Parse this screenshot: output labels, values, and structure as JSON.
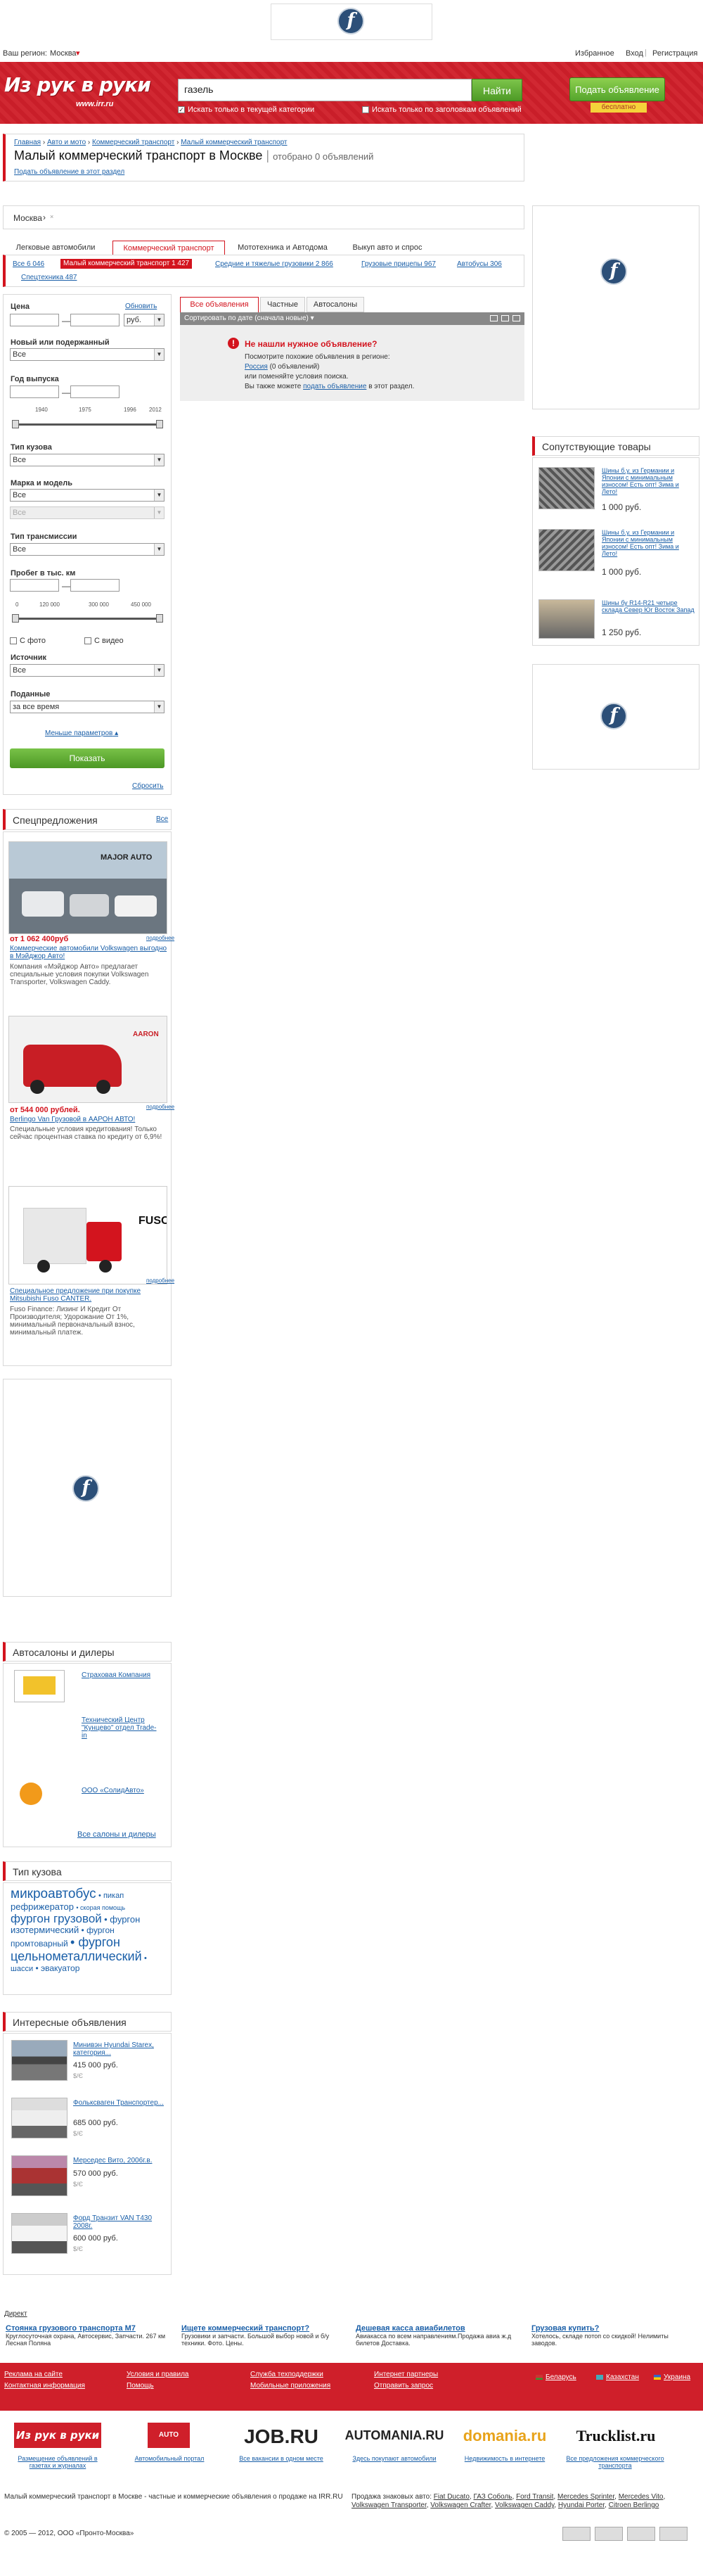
{
  "top": {
    "region_label": "Ваш регион:",
    "region_value": "Москва",
    "favorites": "Избранное",
    "login": "Вход",
    "register": "Регистрация"
  },
  "header": {
    "logo": "Из рук в руки",
    "logo_domain": "www.irr.ru",
    "search_value": "газель",
    "search_button": "Найти",
    "chk_category": "Искать только в текущей категории",
    "chk_titles": "Искать только по заголовкам объявлений",
    "post_ad": "Подать объявление",
    "free": "бесплатно"
  },
  "breadcrumb": [
    "Главная",
    "Авто и мото",
    "Коммерческий транспорт",
    "Малый коммерческий транспорт"
  ],
  "page": {
    "title": "Малый коммерческий транспорт в Москве",
    "found": "отобрано 0 объявлений",
    "post_link": "Подать объявление в этот раздел"
  },
  "location": {
    "city": "Москва",
    "arrow": "›"
  },
  "cat_tabs": [
    "Легковые автомобили",
    "Коммерческий транспорт",
    "Мототехника и Автодома",
    "Выкуп авто и спрос"
  ],
  "subcats": [
    "Все 6 046",
    "Малый коммерческий транспорт 1 427",
    "Средние и тяжелые грузовики 2 866",
    "Грузовые прицепы 967",
    "Автобусы 306",
    "Спецтехника 487"
  ],
  "filters": {
    "price_label": "Цена",
    "price_reset": "Обновить",
    "currency": "руб.",
    "new_label": "Новый или подержанный",
    "new_value": "Все",
    "year_label": "Год выпуска",
    "year_ticks": [
      "1940",
      "1975",
      "1996",
      "2012"
    ],
    "body_label": "Тип кузова",
    "body_value": "Все",
    "make_label": "Марка и модель",
    "make_value": "Все",
    "model_value": "Все",
    "trans_label": "Тип трансмиссии",
    "trans_value": "Все",
    "mileage_label": "Пробег в тыс. км",
    "mileage_ticks": [
      "0",
      "120 000",
      "300 000",
      "450 000"
    ],
    "photo": "С фото",
    "video": "С видео",
    "source_label": "Источник",
    "source_value": "Все",
    "posted_label": "Поданные",
    "posted_value": "за все время",
    "less_params": "Меньше параметров",
    "show": "Показать",
    "reset": "Сбросить"
  },
  "result_tabs": [
    "Все объявления",
    "Частные",
    "Автосалоны"
  ],
  "sort_label": "Сортировать по дате (сначала новые)",
  "notfound": {
    "title": "Не нашли нужное объявление?",
    "l1": "Посмотрите похожие объявления в регионе:",
    "region": "Россия",
    "region_count": "(0 объявлений)",
    "l2": "или поменяйте условия поиска.",
    "l3": "Вы также можете",
    "l3_link": "подать объявление",
    "l3_end": "в этот раздел."
  },
  "related": {
    "title": "Сопутствующие товары",
    "items": [
      {
        "text": "Шины б.у. из Германии и Японии с минимальным износом! Есть опт! Зима и Лето!",
        "price": "1 000 руб."
      },
      {
        "text": "Шины б.у. из Германии и Японии с минимальным износом! Есть опт! Зима и Лето!",
        "price": "1 000 руб."
      },
      {
        "text": "Шины бу R14-R21 четыре склада Север Юг Восток Запад",
        "price": "1 250 руб."
      }
    ]
  },
  "special": {
    "title": "Спецпредложения",
    "all": "Все",
    "promo": "подробнее",
    "items": [
      {
        "price": "от 1 062 400руб",
        "link": "Коммерческие автомобили Volkswagen выгодно в Мэйджор Авто!",
        "text": "Компания «Мэйджор Авто» предлагает специальные условия покупки Volkswagen Transporter, Volkswagen Caddy."
      },
      {
        "price": "от 544 000 рублей.",
        "link": "Berlingo Van Грузовой в ААРОН АВТО!",
        "text": "Специальные условия кредитования! Только сейчас процентная ставка по кредиту от 6,9%!"
      },
      {
        "price": "",
        "link": "Специальное предложение при покупке Mitsubishi Fuso CANTER.",
        "text": "Fuso Finance: Лизинг И Кредит От Производителя; Удорожание От 1%, минимальный первоначальный взнос, минимальный платеж."
      }
    ]
  },
  "dealers": {
    "title": "Автосалоны и дилеры",
    "items": [
      "Страховая Компания",
      "Технический Центр \"Кунцево\" отдел Trade-in",
      "ООО «СолидАвто»"
    ],
    "all": "Все салоны и дилеры"
  },
  "body_types": {
    "title": "Тип кузова",
    "tags": [
      "микроавтобус",
      "пикап",
      "рефрижератор",
      "скорая помощь",
      "фургон грузовой",
      "фургон изотермический",
      "фургон",
      "промтоварный",
      "фургон",
      "цельнометаллический",
      "шасси",
      "эвакуатор"
    ]
  },
  "interesting": {
    "title": "Интересные объявления",
    "items": [
      {
        "title": "Минивэн Hyundai Starex, категория...",
        "price": "415 000 руб.",
        "cur": "$/Є"
      },
      {
        "title": "Фольксваген Транспортер...",
        "price": "685 000 руб.",
        "cur": "$/Є"
      },
      {
        "title": "Мерседес Вито, 2006г.в.",
        "price": "570 000 руб.",
        "cur": "$/Є"
      },
      {
        "title": "Форд Транзит VAN T430 2008г.",
        "price": "600 000 руб.",
        "cur": "$/Є"
      }
    ]
  },
  "direct": {
    "label": "Директ",
    "ads": [
      {
        "title": "Стоянка грузового транспорта М7",
        "text": "Круглосуточная охрана, Автосервис, Запчасти. 267 км Лесная Поляна"
      },
      {
        "title": "Ищете коммерческий транспорт?",
        "text": "Грузовики и запчасти. Большой выбор новой и б/у техники. Фото. Цены."
      },
      {
        "title": "Дешевая касса авиабилетов",
        "text": "Авиакасса по всем направлениям.Продажа авиа ж.д билетов Доставка."
      },
      {
        "title": "Грузовая купить?",
        "text": "Хотелось, складе потоп со скидкой! Нелимиты заводов."
      }
    ]
  },
  "footer_links": [
    [
      "Реклама на сайте",
      "Контактная информация"
    ],
    [
      "Условия и правила",
      "Помощь"
    ],
    [
      "Служба техподдержки",
      "Мобильные приложения"
    ],
    [
      "Интернет партнеры",
      "Отправить запрос"
    ]
  ],
  "footer_flags": [
    "Беларусь",
    "Казахстан",
    "Украина"
  ],
  "partners": [
    {
      "name": "Из рук в руки",
      "desc": "Размещение объявлений в газетах и журналах"
    },
    {
      "name": "AUTO",
      "desc": "Автомобильный портал"
    },
    {
      "name": "JOB.RU",
      "desc": "Все вакансии в одном месте"
    },
    {
      "name": "AUTOMANIA.RU",
      "desc": "Здесь покупают автомобили"
    },
    {
      "name": "domania.ru",
      "desc": "Недвижимость в интернете"
    },
    {
      "name": "Trucklist.ru",
      "desc": "Все предложения коммерческого транспорта"
    }
  ],
  "seo_left": "Малый коммерческий транспорт в Москве - частные и коммерческие объявления о продаже на IRR.RU",
  "seo_right_label": "Продажа знаковых авто:",
  "seo_right": [
    "Fiat Ducato",
    "ГАЗ Соболь",
    "Ford Transit",
    "Mercedes Sprinter",
    "Mercedes Vito",
    "Volkswagen Transporter",
    "Volkswagen Crafter",
    "Volkswagen Caddy",
    "Hyundai Porter",
    "Citroen Berlingo"
  ],
  "copyright": "© 2005 — 2012, ООО «Пронто-Москва»"
}
